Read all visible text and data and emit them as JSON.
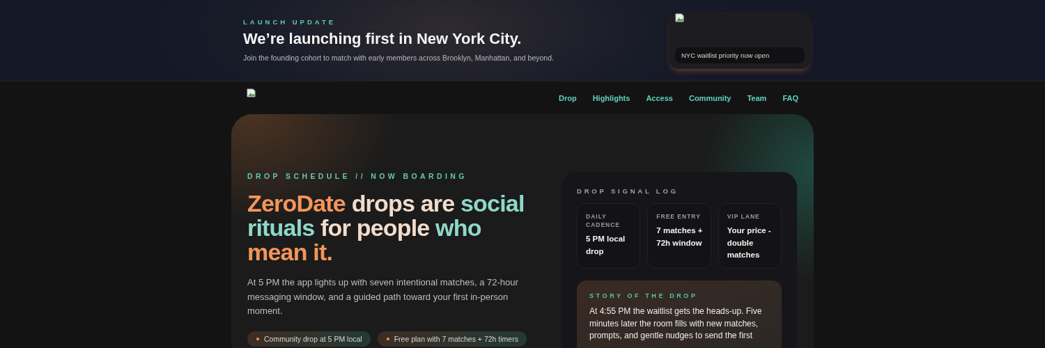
{
  "announcement": {
    "eyebrow": "LAUNCH UPDATE",
    "title": "We’re launching first in New York City.",
    "subtitle": "Join the founding cohort to match with early members across Brooklyn, Manhattan, and beyond.",
    "card_caption": "NYC waitlist priority now open"
  },
  "nav": {
    "links": [
      "Drop",
      "Highlights",
      "Access",
      "Community",
      "Team",
      "FAQ"
    ]
  },
  "hero": {
    "eyebrow": "DROP SCHEDULE // NOW BOARDING",
    "headline": [
      {
        "text": "ZeroDate ",
        "color": "#f4955a"
      },
      {
        "text": "drops are ",
        "color": "#f2dccc"
      },
      {
        "text": "social rituals ",
        "color": "#8fd8c8"
      },
      {
        "text": "for people ",
        "color": "#f2dccc"
      },
      {
        "text": "who ",
        "color": "#8fd8c8"
      },
      {
        "text": "mean it.",
        "color": "#f4955a"
      }
    ],
    "description": "At 5 PM the app lights up with seven intentional matches, a 72-hour messaging window, and a guided path toward your first in-person moment.",
    "pills": [
      "Community drop at 5 PM local",
      "Free plan with 7 matches + 72h timers"
    ]
  },
  "signal_log": {
    "title": "DROP SIGNAL LOG",
    "stats": [
      {
        "label": "DAILY CADENCE",
        "value": "5 PM local drop"
      },
      {
        "label": "FREE ENTRY",
        "value": "7 matches + 72h window"
      },
      {
        "label": "VIP LANE",
        "value": "Your price - double matches"
      }
    ],
    "story": {
      "title": "STORY OF THE DROP",
      "text": "At 4:55 PM the waitlist gets the heads-up. Five minutes later the room fills with new matches, prompts, and gentle nudges to send the first"
    }
  }
}
